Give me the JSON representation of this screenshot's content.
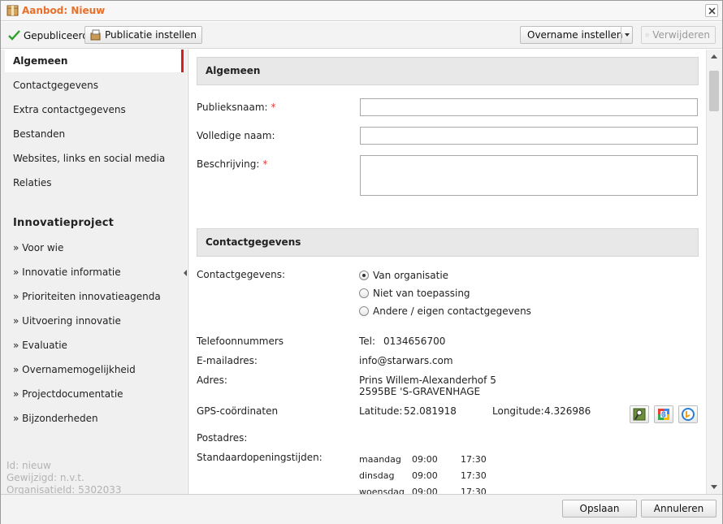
{
  "window": {
    "title": "Aanbod: Nieuw"
  },
  "toolbar": {
    "published_label": "Gepubliceerd",
    "publication_settings_label": "Publicatie instellen",
    "takeover_settings_label": "Overname instellen",
    "delete_label": "Verwijderen"
  },
  "sidebar": {
    "items": [
      {
        "label": "Algemeen"
      },
      {
        "label": "Contactgegevens"
      },
      {
        "label": "Extra contactgegevens"
      },
      {
        "label": "Bestanden"
      },
      {
        "label": "Websites, links en social media"
      },
      {
        "label": "Relaties"
      }
    ],
    "innovation_heading": "Innovatieproject",
    "innovation_items": [
      {
        "label": "» Voor wie"
      },
      {
        "label": "» Innovatie informatie"
      },
      {
        "label": "» Prioriteiten innovatieagenda"
      },
      {
        "label": "» Uitvoering innovatie"
      },
      {
        "label": "» Evaluatie"
      },
      {
        "label": "» Overnamemogelijkheid"
      },
      {
        "label": "» Projectdocumentatie"
      },
      {
        "label": "» Bijzonderheden"
      }
    ],
    "meta": {
      "id": "Id: nieuw",
      "modified": "Gewijzigd: n.v.t.",
      "org_id": "OrganisatieId: 5302033"
    }
  },
  "general": {
    "header": "Algemeen",
    "public_name_label": "Publieksnaam:",
    "public_name_value": "",
    "full_name_label": "Volledige naam:",
    "full_name_value": "",
    "description_label": "Beschrijving:",
    "description_value": "",
    "required_mark": "*"
  },
  "contact": {
    "header": "Contactgegevens",
    "contact_label": "Contactgegevens:",
    "options": [
      {
        "label": "Van organisatie",
        "checked": true
      },
      {
        "label": "Niet van toepassing",
        "checked": false
      },
      {
        "label": "Andere / eigen contactgegevens",
        "checked": false
      }
    ],
    "phone_label": "Telefoonnummers",
    "phone_prefix": "Tel:",
    "phone_value": "0134656700",
    "email_label": "E-mailadres:",
    "email_value": "info@starwars.com",
    "address_label": "Adres:",
    "address_line1": "Prins Willem-Alexanderhof 5",
    "address_line2": "2595BE 'S-GRAVENHAGE",
    "gps_label": "GPS-coördinaten",
    "latitude_label": "Latitude:",
    "latitude_value": "52.081918",
    "longitude_label": "Longitude:",
    "longitude_value": "4.326986",
    "postal_label": "Postadres:",
    "hours_label": "Standaardopeningstijden:",
    "hours": [
      {
        "day": "maandag",
        "open": "09:00",
        "close": "17:30"
      },
      {
        "day": "dinsdag",
        "open": "09:00",
        "close": "17:30"
      },
      {
        "day": "woensdag",
        "open": "09:00",
        "close": "17:30"
      }
    ]
  },
  "footer": {
    "save_label": "Opslaan",
    "cancel_label": "Annuleren"
  },
  "colors": {
    "title": "#e8702a",
    "active_marker": "#d42020",
    "required": "#e23a3a"
  }
}
